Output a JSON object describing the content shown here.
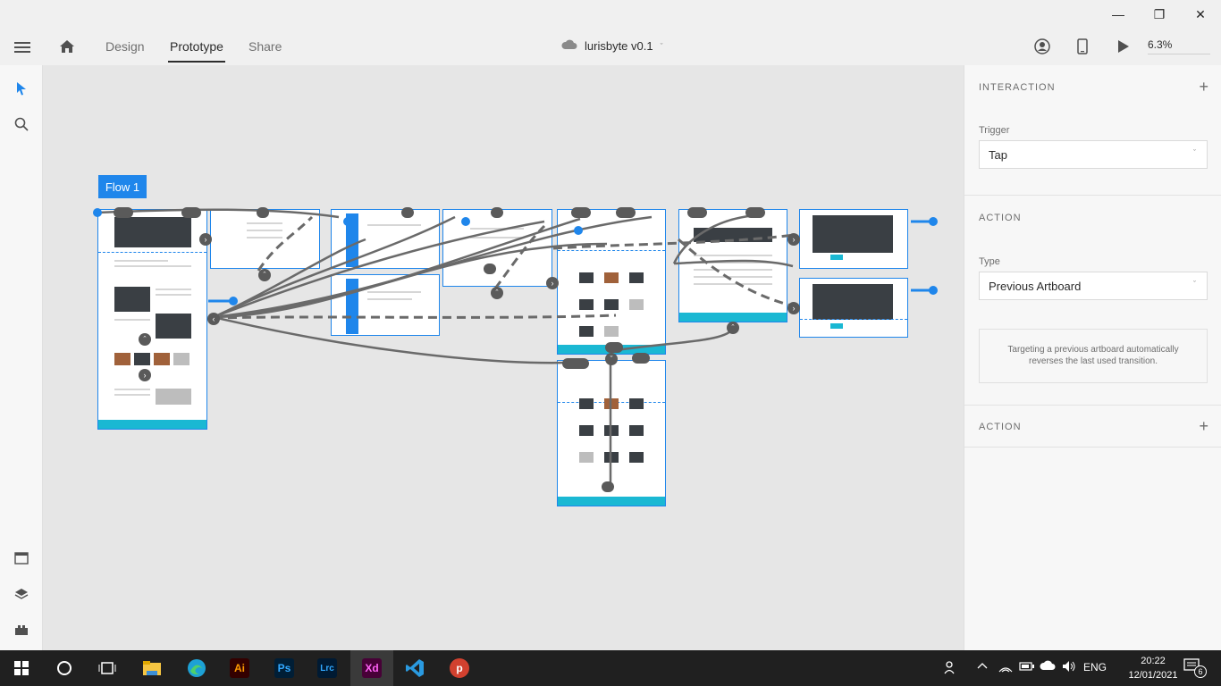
{
  "window": {
    "minimize": "—",
    "restore": "❐",
    "close": "✕"
  },
  "appbar": {
    "tabs": [
      {
        "label": "Design"
      },
      {
        "label": "Prototype"
      },
      {
        "label": "Share"
      }
    ],
    "active_tab": "Prototype",
    "document_title": "lurisbyte v0.1",
    "zoom": "6.3%"
  },
  "canvas": {
    "flow_label": "Flow 1"
  },
  "interaction_panel": {
    "interaction_header": "INTERACTION",
    "trigger_label": "Trigger",
    "trigger_value": "Tap",
    "action_header": "ACTION",
    "type_label": "Type",
    "type_value": "Previous Artboard",
    "note": "Targeting a previous artboard automatically reverses the last used transition.",
    "second_action_header": "ACTION"
  },
  "taskbar": {
    "apps": [
      "Start",
      "Search",
      "Task View",
      "File Explorer",
      "Edge",
      "Illustrator",
      "Photoshop",
      "Lightroom Classic",
      "Adobe XD",
      "VS Code",
      "Psiphon"
    ],
    "app_labels": {
      "ai": "Ai",
      "ps": "Ps",
      "lrc": "Lrc",
      "xd": "Xd",
      "ph": "p"
    },
    "language": "ENG",
    "time": "20:22",
    "date": "12/01/2021",
    "notifications": "6"
  },
  "colors": {
    "accent": "#1f86eb",
    "footer_cyan": "#1ab8d3",
    "taskbar": "#202020"
  }
}
